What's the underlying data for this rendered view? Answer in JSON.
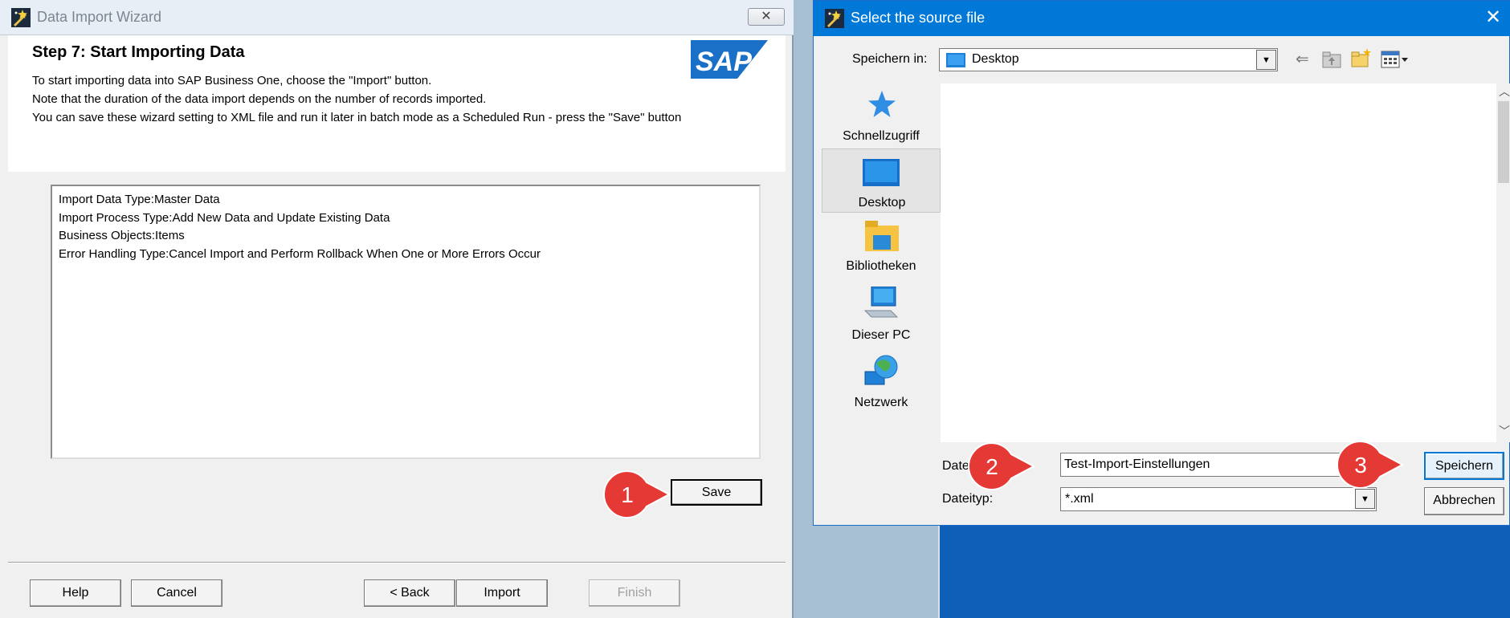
{
  "wizard": {
    "title": "Data Import Wizard",
    "close_glyph": "✕",
    "step_title": "Step 7: Start Importing Data",
    "logo_text": "SAP",
    "description": [
      "To start importing data into SAP Business One, choose the \"Import\" button.",
      "Note that the duration of the data import depends on the number of records imported.",
      "You can save these wizard setting to XML file and run it later in batch mode as a Scheduled Run - press the \"Save\" button"
    ],
    "summary": [
      "Import Data Type:Master Data",
      "Import Process Type:Add New Data and Update Existing Data",
      "Business Objects:Items",
      "Error Handling Type:Cancel Import and Perform Rollback When One or More Errors Occur"
    ],
    "save_label": "Save",
    "help_label": "Help",
    "cancel_label": "Cancel",
    "back_label": "< Back",
    "import_label": "Import",
    "finish_label": "Finish"
  },
  "dialog": {
    "title": "Select the source file",
    "close_glyph": "✕",
    "savein_label": "Speichern in:",
    "savein_value": "Desktop",
    "places": [
      {
        "label": "Schnellzugriff",
        "icon": "star-icon"
      },
      {
        "label": "Desktop",
        "icon": "desktop-icon"
      },
      {
        "label": "Bibliotheken",
        "icon": "library-folder-icon"
      },
      {
        "label": "Dieser PC",
        "icon": "computer-icon"
      },
      {
        "label": "Netzwerk",
        "icon": "network-globe-icon"
      }
    ],
    "filename_label": "Dateiname:",
    "filename_value": "Test-Import-Einstellungen",
    "filetype_label": "Dateityp:",
    "filetype_value": "*.xml",
    "save_label": "Speichern",
    "cancel_label": "Abbrechen"
  },
  "callouts": [
    "1",
    "2",
    "3"
  ],
  "colors": {
    "title_blue": "#0078d7",
    "callout_red": "#e53935",
    "background_blue": "#0f5fb6"
  }
}
